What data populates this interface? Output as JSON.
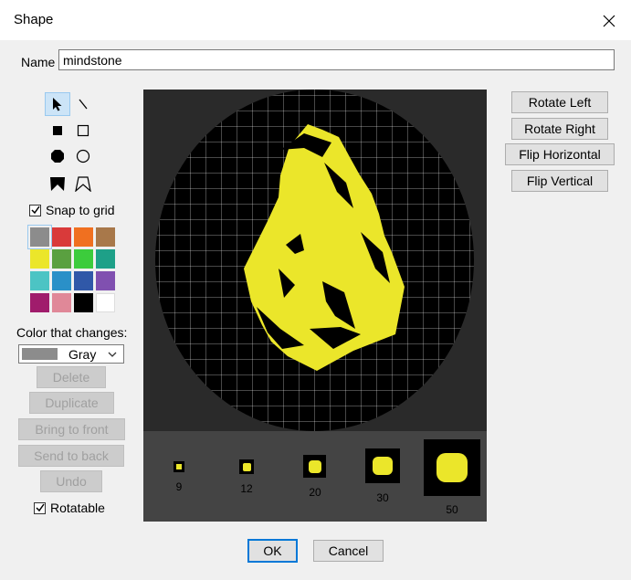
{
  "window": {
    "title": "Shape"
  },
  "name": {
    "label": "Name",
    "value": "mindstone"
  },
  "tools": [
    "select-tool",
    "line-tool",
    "filled-rect-tool",
    "rect-tool",
    "filled-ellipse-tool",
    "ellipse-tool",
    "filled-polygon-tool",
    "polygon-tool"
  ],
  "snap_to_grid": {
    "label": "Snap to grid",
    "checked": true
  },
  "palette": [
    "#8c8c8c",
    "#d93a3a",
    "#f07020",
    "#a8784a",
    "#ebe62a",
    "#5aa040",
    "#3ccc3c",
    "#1ea088",
    "#4cc4c4",
    "#2a90c8",
    "#3058a8",
    "#8050b0",
    "#a01c6c",
    "#e08898",
    "#000000",
    "#ffffff"
  ],
  "color_changes": {
    "label": "Color that changes:",
    "selected": "Gray",
    "swatch": "#8c8c8c"
  },
  "buttons": {
    "delete": "Delete",
    "duplicate": "Duplicate",
    "bring_to_front": "Bring to front",
    "send_to_back": "Send to back",
    "undo": "Undo",
    "rotate_left": "Rotate Left",
    "rotate_right": "Rotate Right",
    "flip_horizontal": "Flip Horizontal",
    "flip_vertical": "Flip Vertical",
    "ok": "OK",
    "cancel": "Cancel"
  },
  "rotatable": {
    "label": "Rotatable",
    "checked": true
  },
  "preview_sizes": [
    "9",
    "12",
    "20",
    "30",
    "50"
  ],
  "colors": {
    "shape": "#ebe62a",
    "accent": "#0078d7"
  }
}
